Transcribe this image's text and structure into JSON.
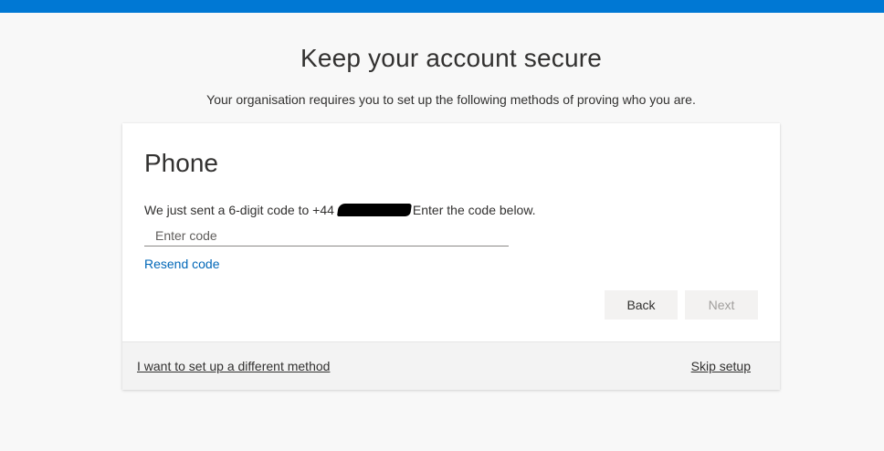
{
  "header": {
    "accent_color": "#0078d4"
  },
  "page": {
    "title": "Keep your account secure",
    "subtitle": "Your organisation requires you to set up the following methods of proving who you are."
  },
  "method": {
    "title": "Phone",
    "info_prefix": "We just sent a 6-digit code to +44",
    "info_suffix": "Enter the code below.",
    "code_input": {
      "value": "",
      "placeholder": "Enter code"
    },
    "resend_label": "Resend code",
    "back_label": "Back",
    "next_label": "Next"
  },
  "footer": {
    "different_method_label": "I want to set up a different method",
    "skip_label": "Skip setup"
  },
  "colors": {
    "link": "#0067b8",
    "button_bg": "#f3f2f1",
    "disabled_text": "#a19f9d"
  }
}
